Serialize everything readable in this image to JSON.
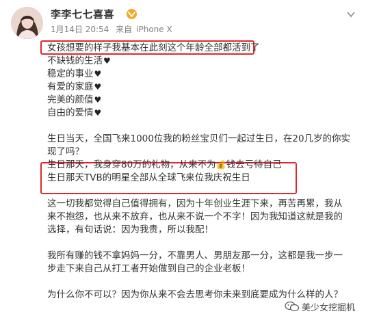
{
  "post": {
    "username": "李李七七喜喜",
    "date": "1月14日 20:54",
    "source_prefix": "来自",
    "source": "iPhone X",
    "lines": {
      "l1": "女孩想要的样子我基本在此刻这个年龄全部都活到了",
      "l2": "不缺钱的生活",
      "l3": "稳定的事业",
      "l4": "有爱的家庭",
      "l5": "完美的颜值",
      "l6": "自由的爱情",
      "p2": "生日当天，全国飞来1000位我的粉丝宝贝们一起过生日，在20几岁的你实现了吗？",
      "p3a_before": "生日那天，我身穿80万的礼物，从来不为",
      "p3a_icon": "💰",
      "p3a_after": "钱去亏待自己",
      "p3b": "生日那天TVB的明星全部从全球飞来位我庆祝生日",
      "p4": "这一切我都觉得自己值得拥有，因为十年创业生涯下来，再苦再累，我从来不抱怨，也从来不放弃，也从来不说一个不字！因为我知道这就是我的选择，有句话说：因为我贵，所以我配！",
      "p5": "我所有赚的钱不拿妈妈一分，不靠男人、男朋友那一分，这都是我一步一步走下来自己从打工者开始做到自己的企业老板！",
      "p6": "为什么你不可以？因为你从来不会去思考你未来到底要成为什么样的人？"
    },
    "heart": "♥"
  },
  "watermark": {
    "text": "美少女挖掘机",
    "icon": "wechat-icon"
  },
  "colors": {
    "highlight_border": "#e3262c",
    "meta_gray": "#808080",
    "text": "#333333"
  }
}
